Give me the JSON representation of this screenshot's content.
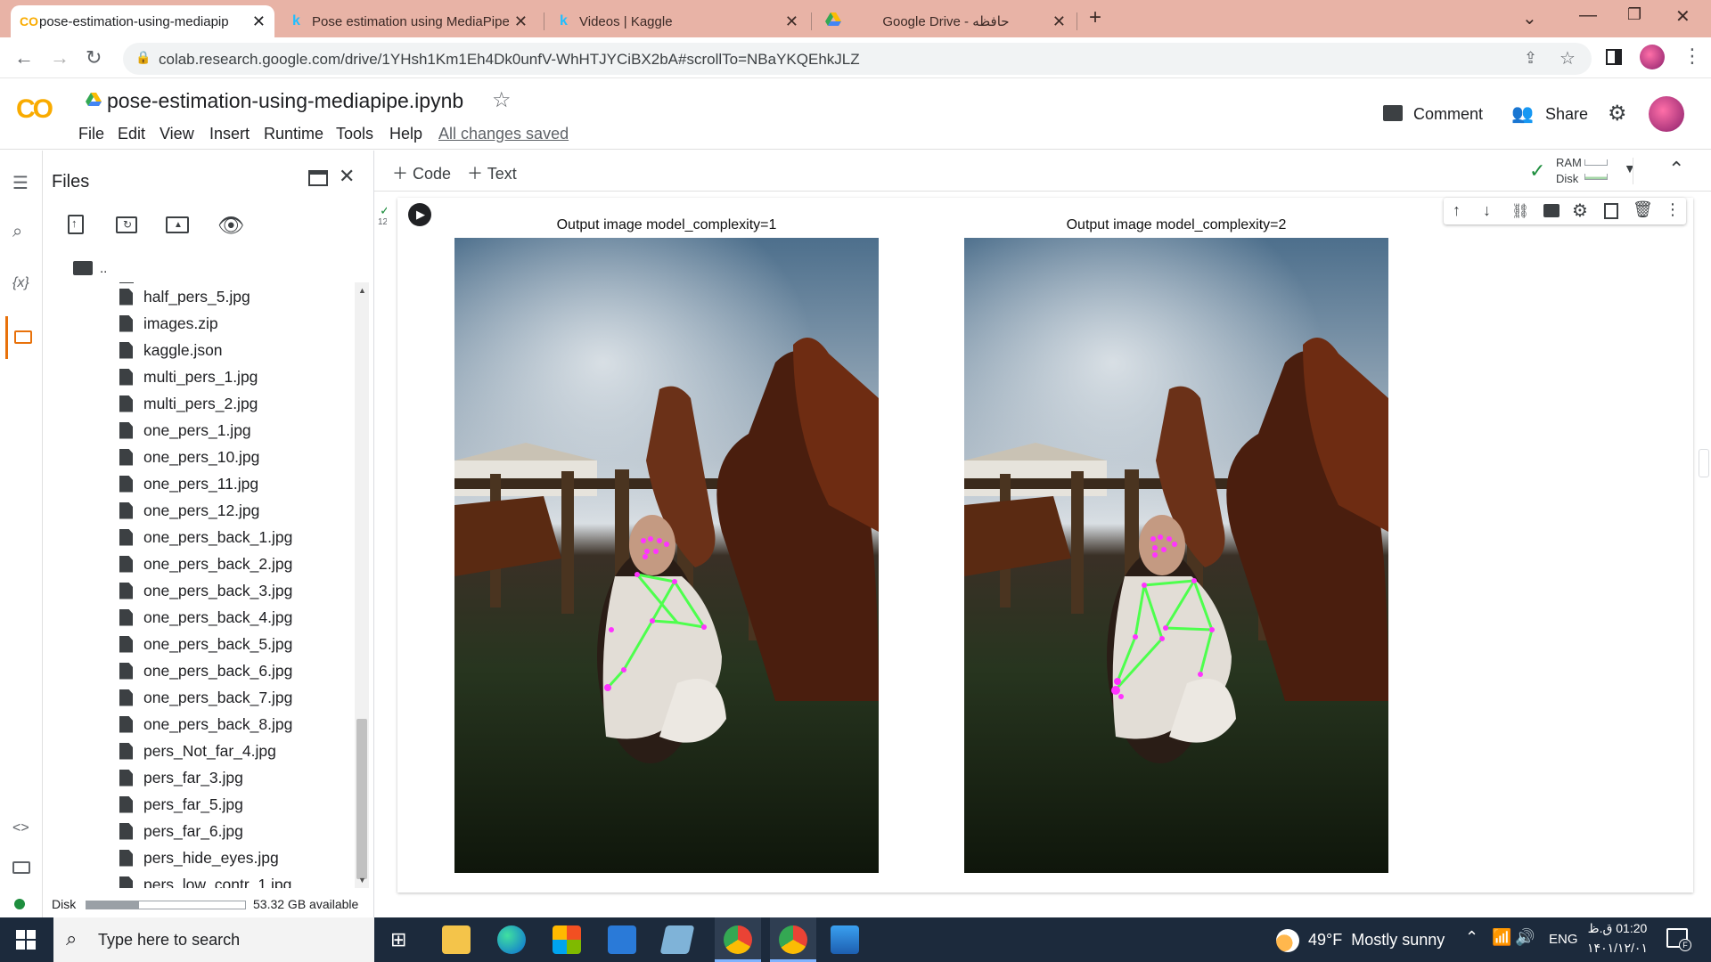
{
  "browser": {
    "tabs": [
      {
        "favicon": "colab-icon",
        "title": "pose-estimation-using-mediapip",
        "active": true
      },
      {
        "favicon": "kaggle-icon",
        "title": "Pose estimation using MediaPipe",
        "active": false
      },
      {
        "favicon": "kaggle-icon",
        "title": "Videos | Kaggle",
        "active": false
      },
      {
        "favicon": "google-drive-icon",
        "title": "Google Drive - حافظه",
        "active": false
      }
    ],
    "url": "colab.research.google.com/drive/1YHsh1Km1Eh4Dk0unfV-WhHTJYCiBX2bA#scrollTo=NBaYKQEhkJLZ"
  },
  "colab": {
    "logo": "CO",
    "notebook_name": "pose-estimation-using-mediapipe.ipynb",
    "menu": [
      "File",
      "Edit",
      "View",
      "Insert",
      "Runtime",
      "Tools",
      "Help"
    ],
    "save_status": "All changes saved",
    "comment_label": "Comment",
    "share_label": "Share"
  },
  "files_panel": {
    "title": "Files",
    "parent_dir": "..",
    "items": [
      "half_pers_5.jpg",
      "images.zip",
      "kaggle.json",
      "multi_pers_1.jpg",
      "multi_pers_2.jpg",
      "one_pers_1.jpg",
      "one_pers_10.jpg",
      "one_pers_11.jpg",
      "one_pers_12.jpg",
      "one_pers_back_1.jpg",
      "one_pers_back_2.jpg",
      "one_pers_back_3.jpg",
      "one_pers_back_4.jpg",
      "one_pers_back_5.jpg",
      "one_pers_back_6.jpg",
      "one_pers_back_7.jpg",
      "one_pers_back_8.jpg",
      "pers_Not_far_4.jpg",
      "pers_far_3.jpg",
      "pers_far_5.jpg",
      "pers_far_6.jpg",
      "pers_hide_eyes.jpg",
      "pers_low_contr_1.jpg"
    ],
    "disk_label": "Disk",
    "disk_available": "53.32 GB available",
    "disk_used_fraction": 0.33
  },
  "notebook_toolbar": {
    "code_label": "Code",
    "text_label": "Text",
    "ram_label": "RAM",
    "disk_label": "Disk"
  },
  "cell": {
    "exec_time": "12s",
    "plots": [
      {
        "title": "Output image model_complexity=1"
      },
      {
        "title": "Output image model_complexity=2"
      }
    ]
  },
  "taskbar": {
    "search_placeholder": "Type here to search",
    "weather": "49°F  Mostly sunny",
    "language": "ENG",
    "time": "01:20 ق.ظ",
    "date": "۱۴۰۱/۱۲/۰۱",
    "notification_count": "F"
  },
  "colors": {
    "tab_strip": "#e8b3a6",
    "accent_orange": "#f9ab00",
    "pose_green": "#4dff4d",
    "pose_magenta": "#ff33ff",
    "taskbar": "#1c2a3c"
  }
}
